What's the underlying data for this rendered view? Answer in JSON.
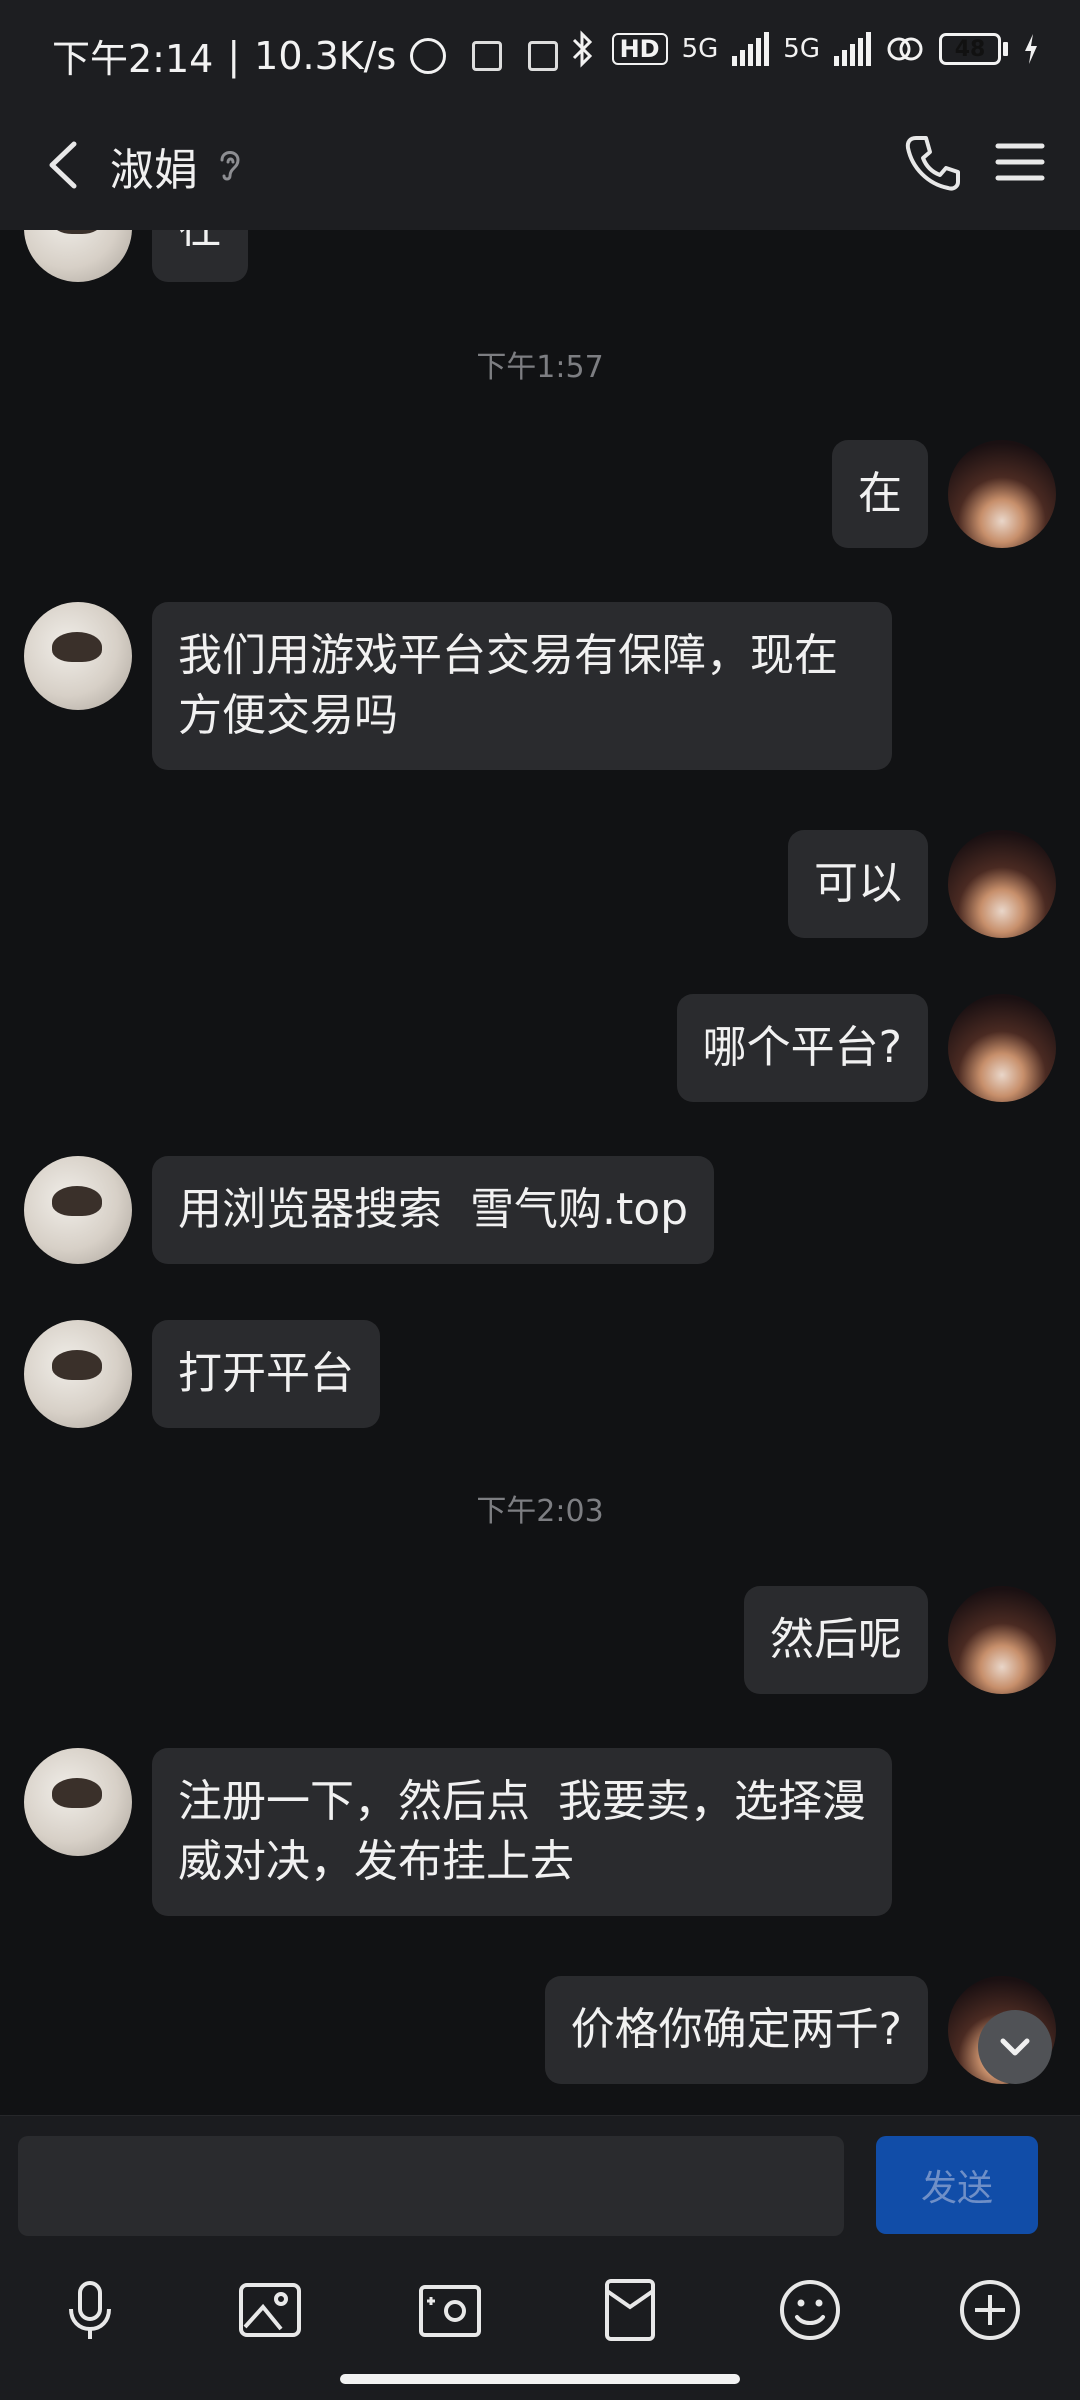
{
  "status_bar": {
    "time": "下午2:14",
    "speed": "10.3K/s",
    "network1": "5G",
    "network2": "5G",
    "hd_label": "HD",
    "battery": "48"
  },
  "header": {
    "title": "淑娟"
  },
  "messages": [
    {
      "side": "left",
      "text": "在"
    },
    {
      "type": "time",
      "text": "下午1:57"
    },
    {
      "side": "right",
      "text": "在"
    },
    {
      "side": "left",
      "text": "我们用游戏平台交易有保障，现在方便交易吗"
    },
    {
      "side": "right",
      "text": "可以"
    },
    {
      "side": "right",
      "text": "哪个平台?"
    },
    {
      "side": "left",
      "text": "用浏览器搜索  雪气购.top"
    },
    {
      "side": "left",
      "text": "打开平台"
    },
    {
      "type": "time",
      "text": "下午2:03"
    },
    {
      "side": "right",
      "text": "然后呢"
    },
    {
      "side": "left",
      "text": "注册一下，然后点  我要卖，选择漫威对决，发布挂上去"
    },
    {
      "side": "right",
      "text": "价格你确定两千?"
    }
  ],
  "input": {
    "send_label": "发送"
  },
  "toolbar": {
    "icons": [
      "microphone-icon",
      "image-icon",
      "camera-icon",
      "red-packet-icon",
      "emoji-icon",
      "add-icon"
    ]
  },
  "colors": {
    "background": "#111214",
    "bubble": "#2a2b2e",
    "send_button": "#114da8",
    "battery_fill": "#5fd35f"
  }
}
